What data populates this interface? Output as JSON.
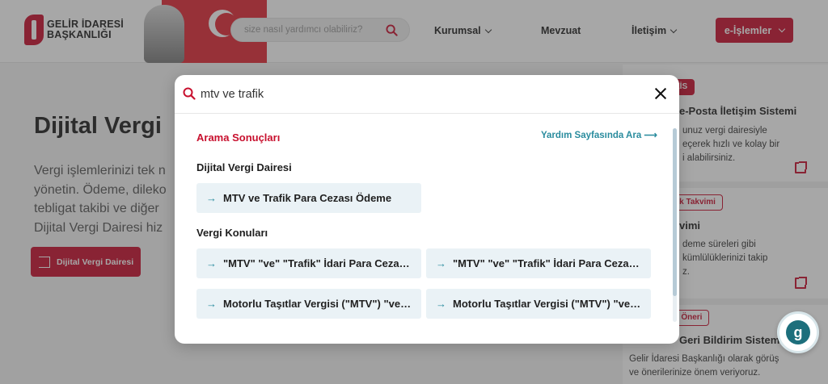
{
  "header": {
    "logo_line1": "GELİR İDARESİ",
    "logo_line2": "BAŞKANLIĞI",
    "search_placeholder": "size nasıl yardımcı olabiliriz?",
    "nav": [
      {
        "label": "Kurumsal",
        "has_dropdown": true
      },
      {
        "label": "Mevzuat",
        "has_dropdown": false
      },
      {
        "label": "İletişim",
        "has_dropdown": true
      }
    ],
    "eislemler_label": "e-İşlemler",
    "icons": {
      "search": "search-icon",
      "chevron": "chevron-down-icon"
    }
  },
  "page": {
    "hero_title": "Dijital Vergi",
    "hero_lines": [
      "Vergi işlemlerinizi tek n",
      "yönetin. Ödeme, dileko",
      "tebligat takibi ve diğer",
      "Dijital Vergi Dairesi hiz"
    ],
    "hero_button": "Dijital Vergi Dairesi",
    "right_cards": [
      {
        "tag": "EİS",
        "title": "e-Posta İletişim Sistemi",
        "lines": [
          "unuz vergi dairesiyle",
          "eçerek hızlı ve kolay bir",
          "i alabilirsiniz."
        ]
      },
      {
        "tag": "ük Takvimi",
        "title": "vimi",
        "lines": [
          "deme süreleri gibi",
          "kümlülüklerinizi takip",
          "z."
        ]
      },
      {
        "tag": "e Öneri",
        "title": "Geri Bildirim Sistemi",
        "lines": [
          "Gelir İdaresi Başkanlığı olarak görüş",
          "ve önerilerinize önem veriyoruz."
        ]
      }
    ]
  },
  "modal": {
    "query": "mtv ve trafik",
    "results_title": "Arama Sonuçları",
    "help_link": "Yardım Sayfasında Ara ⟶",
    "sections": [
      {
        "title": "Dijital Vergi Dairesi",
        "items": [
          "MTV ve Trafik Para Cezası Ödeme"
        ]
      },
      {
        "title": "Vergi Konuları",
        "items": [
          "\"MTV\" \"ve\" \"Trafik\" İdari Para Cezası Ödeme",
          "\"MTV\" \"ve\" \"Trafik\" İdari Para Cezası Ödeme",
          "Motorlu Taşıtlar Vergisi (\"MTV\") \"ve\" Trafik",
          "Motorlu Taşıtlar Vergisi (\"MTV\") \"ve\" Trafik"
        ]
      }
    ],
    "item_arrow": "→",
    "icons": {
      "search": "search-icon",
      "close": "close-icon",
      "arrow": "arrow-right-icon"
    }
  },
  "colors": {
    "brand_red": "#c8102e",
    "teal": "#2a8c9e",
    "result_bg": "#eaf2f6"
  }
}
